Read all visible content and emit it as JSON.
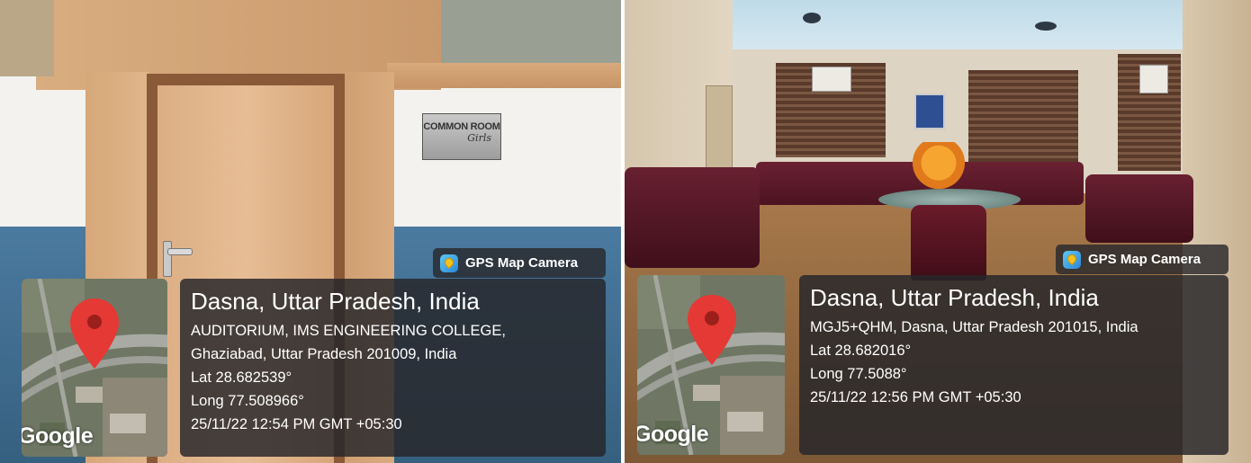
{
  "photos": [
    {
      "sign": {
        "line1": "COMMON ROOM",
        "line2": "Girls"
      },
      "badge_label": "GPS Map Camera",
      "city": "Dasna, Uttar Pradesh, India",
      "address_line1": "AUDITORIUM, IMS ENGINEERING COLLEGE,",
      "address_line2": "Ghaziabad, Uttar Pradesh 201009, India",
      "lat": "Lat 28.682539°",
      "long": "Long 77.508966°",
      "timestamp": "25/11/22 12:54 PM GMT +05:30",
      "map_brand": "Google"
    },
    {
      "badge_label": "GPS Map Camera",
      "city": "Dasna, Uttar Pradesh, India",
      "address_line1": "MGJ5+QHM, Dasna, Uttar Pradesh 201015, India",
      "lat": "Lat 28.682016°",
      "long": "Long 77.5088°",
      "timestamp": "25/11/22 12:56 PM GMT +05:30",
      "map_brand": "Google"
    }
  ],
  "colors": {
    "pin": "#e53935",
    "overlay": "#26262a",
    "wood": "#d8a87a",
    "wall_blue": "#3f6f95",
    "sofa": "#5a1a2a"
  },
  "icons": [
    "gps-map-camera-icon",
    "location-pin-icon"
  ]
}
